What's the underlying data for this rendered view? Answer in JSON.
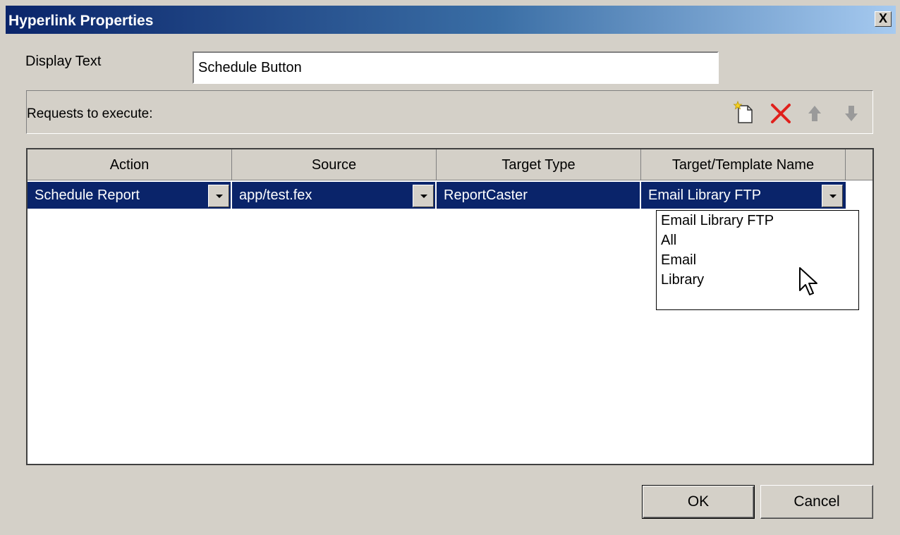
{
  "window": {
    "title": "Hyperlink Properties",
    "close_label": "X"
  },
  "display_text": {
    "label": "Display Text",
    "value": "Schedule Button"
  },
  "requests": {
    "label": "Requests to execute:",
    "toolbar_icons": [
      "new-request-icon",
      "delete-icon",
      "move-up-icon",
      "move-down-icon"
    ]
  },
  "grid": {
    "headers": [
      "Action",
      "Source",
      "Target Type",
      "Target/Template Name"
    ],
    "row": {
      "action": "Schedule Report",
      "source": "app/test.fex",
      "target_type": "ReportCaster",
      "target_name": "Email Library FTP"
    }
  },
  "dropdown": {
    "options": [
      "Email Library FTP",
      "All",
      "Email",
      "Library"
    ]
  },
  "buttons": {
    "ok": "OK",
    "cancel": "Cancel"
  },
  "colors": {
    "title_gradient_start": "#0a246a",
    "selection": "#0a246a",
    "face": "#d4d0c8",
    "delete_red": "#e0201c"
  }
}
